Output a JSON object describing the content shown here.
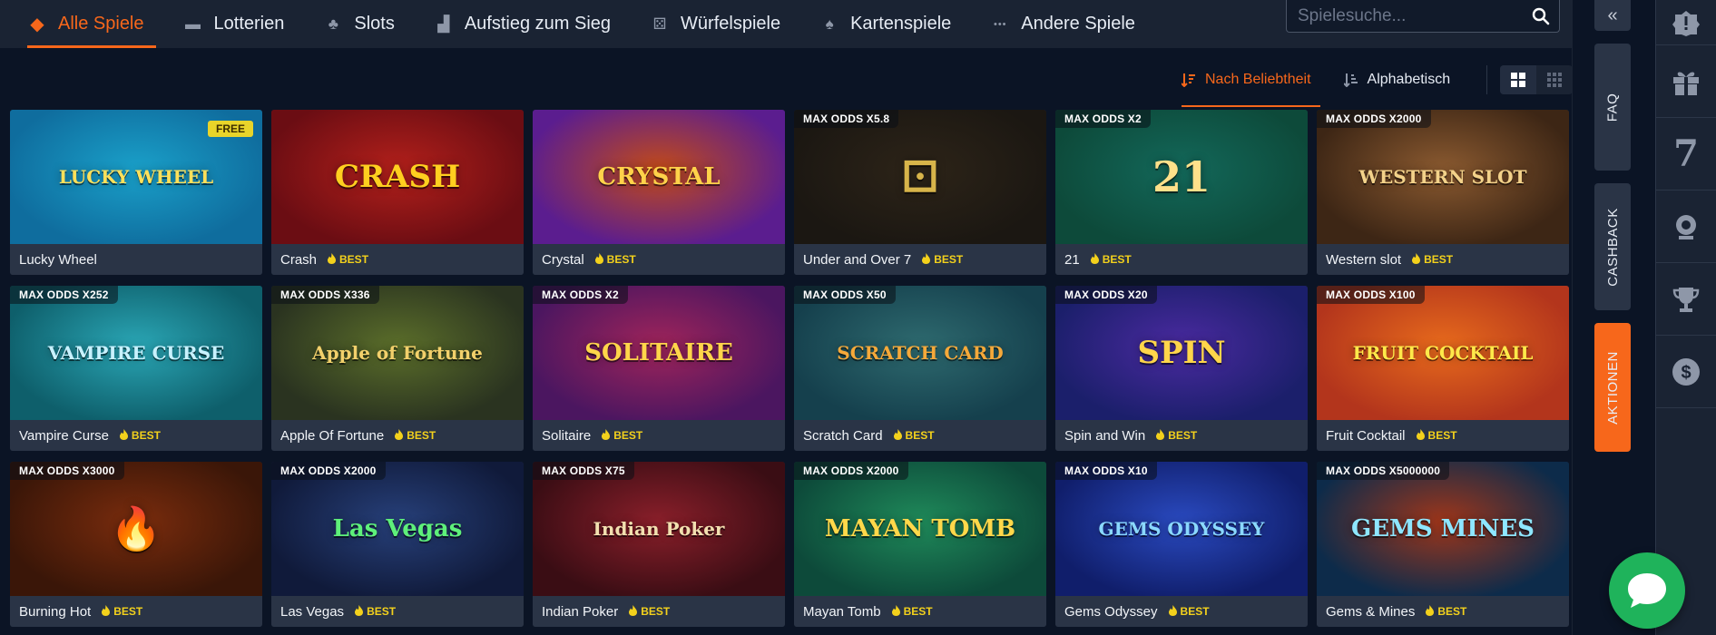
{
  "nav": {
    "items": [
      {
        "label": "Alle Spiele",
        "icon": "gamepad-icon",
        "active": true
      },
      {
        "label": "Lotterien",
        "icon": "ticket-icon",
        "active": false
      },
      {
        "label": "Slots",
        "icon": "cherry-icon",
        "active": false
      },
      {
        "label": "Aufstieg zum Sieg",
        "icon": "stairs-icon",
        "active": false
      },
      {
        "label": "Würfelspiele",
        "icon": "dice-icon",
        "active": false
      },
      {
        "label": "Kartenspiele",
        "icon": "spade-icon",
        "active": false
      },
      {
        "label": "Andere Spiele",
        "icon": "dots-icon",
        "active": false
      }
    ]
  },
  "search": {
    "placeholder": "Spielesuche..."
  },
  "sort": {
    "popularity_label": "Nach Beliebtheit",
    "alphabetical_label": "Alphabetisch"
  },
  "best_label": "BEST",
  "free_label": "FREE",
  "games": [
    {
      "title": "Lucky Wheel",
      "odds": "",
      "best": false,
      "free": true,
      "art": "LUCKY WHEEL",
      "bg": [
        "#0f6d9e",
        "#1aa0c9"
      ],
      "accent": "#ffe05a"
    },
    {
      "title": "Crash",
      "odds": "",
      "best": true,
      "free": false,
      "art": "CRASH",
      "bg": [
        "#6b0d13",
        "#b3201b"
      ],
      "accent": "#ffcf1f"
    },
    {
      "title": "Crystal",
      "odds": "",
      "best": true,
      "free": false,
      "art": "CRYSTAL",
      "bg": [
        "#5b1d8f",
        "#c34b18"
      ],
      "accent": "#ffd24a"
    },
    {
      "title": "Under and Over 7",
      "odds": "MAX ODDS X5.8",
      "best": true,
      "free": false,
      "art": "⚀",
      "bg": [
        "#1b1712",
        "#2d2418"
      ],
      "accent": "#d7b44a"
    },
    {
      "title": "21",
      "odds": "MAX ODDS X2",
      "best": true,
      "free": false,
      "art": "21",
      "bg": [
        "#0d4a3a",
        "#13685a"
      ],
      "accent": "#ffe08a"
    },
    {
      "title": "Western slot",
      "odds": "MAX ODDS X2000",
      "best": true,
      "free": false,
      "art": "WESTERN SLOT",
      "bg": [
        "#3d2615",
        "#8b5a30"
      ],
      "accent": "#f3d28a"
    },
    {
      "title": "Vampire Curse",
      "odds": "MAX ODDS X252",
      "best": true,
      "free": false,
      "art": "VAMPIRE CURSE",
      "bg": [
        "#0e5f6b",
        "#2aa6b5"
      ],
      "accent": "#c8f2ff"
    },
    {
      "title": "Apple Of Fortune",
      "odds": "MAX ODDS X336",
      "best": true,
      "free": false,
      "art": "Apple of Fortune",
      "bg": [
        "#2a3320",
        "#5b6e2a"
      ],
      "accent": "#f2d06b"
    },
    {
      "title": "Solitaire",
      "odds": "MAX ODDS X2",
      "best": true,
      "free": false,
      "art": "SOLITAIRE",
      "bg": [
        "#4b1660",
        "#a0245a"
      ],
      "accent": "#ffd54a"
    },
    {
      "title": "Scratch Card",
      "odds": "MAX ODDS X50",
      "best": true,
      "free": false,
      "art": "SCRATCH CARD",
      "bg": [
        "#15404d",
        "#2e6a6f"
      ],
      "accent": "#f5a93a"
    },
    {
      "title": "Spin and Win",
      "odds": "MAX ODDS X20",
      "best": true,
      "free": false,
      "art": "SPIN",
      "bg": [
        "#1b1f6b",
        "#4a2aa0"
      ],
      "accent": "#ffd54a"
    },
    {
      "title": "Fruit Cocktail",
      "odds": "MAX ODDS X100",
      "best": true,
      "free": false,
      "art": "FRUIT COCKTAIL",
      "bg": [
        "#b3351c",
        "#e76a1c"
      ],
      "accent": "#ffe94a"
    },
    {
      "title": "Burning Hot",
      "odds": "MAX ODDS X3000",
      "best": true,
      "free": false,
      "art": "🔥",
      "bg": [
        "#3a1608",
        "#7a2c0d"
      ],
      "accent": "#f5b23a"
    },
    {
      "title": "Las Vegas",
      "odds": "MAX ODDS X2000",
      "best": true,
      "free": false,
      "art": "Las Vegas",
      "bg": [
        "#101a3a",
        "#27407a"
      ],
      "accent": "#5ef07a"
    },
    {
      "title": "Indian Poker",
      "odds": "MAX ODDS X75",
      "best": true,
      "free": false,
      "art": "Indian Poker",
      "bg": [
        "#3a0d14",
        "#8a1f2a"
      ],
      "accent": "#f2e0b0"
    },
    {
      "title": "Mayan Tomb",
      "odds": "MAX ODDS X2000",
      "best": true,
      "free": false,
      "art": "MAYAN TOMB",
      "bg": [
        "#0d4a3a",
        "#1f8a5a"
      ],
      "accent": "#ffd84a"
    },
    {
      "title": "Gems Odyssey",
      "odds": "MAX ODDS X10",
      "best": true,
      "free": false,
      "art": "GEMS ODYSSEY",
      "bg": [
        "#101e6b",
        "#2a4ac0"
      ],
      "accent": "#8ad8ff"
    },
    {
      "title": "Gems & Mines",
      "odds": "MAX ODDS X5000000",
      "best": true,
      "free": false,
      "art": "GEMS MINES",
      "bg": [
        "#0d2b4a",
        "#a0361a"
      ],
      "accent": "#8ee6ff"
    }
  ],
  "sidebar": {
    "faq_label": "FAQ",
    "cashback_label": "CASHBACK",
    "aktionen_label": "AKTIONEN",
    "rail_seven": "7"
  },
  "colors": {
    "accent": "#f7671b",
    "best": "#f3d11c",
    "chat": "#1fb35b"
  }
}
